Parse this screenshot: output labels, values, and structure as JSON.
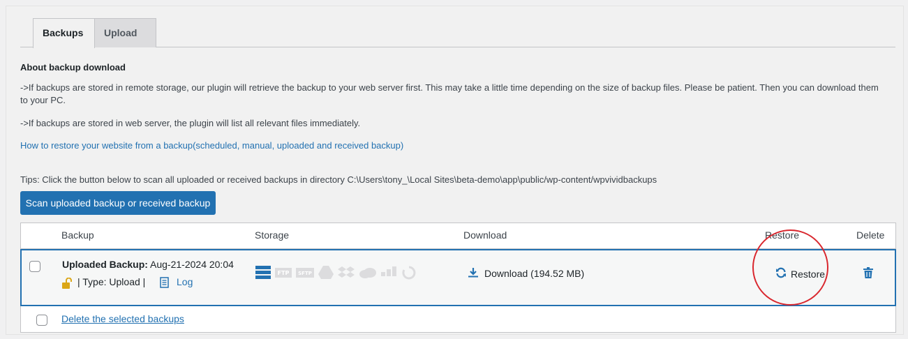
{
  "tabs": [
    {
      "label": "Backups",
      "active": true
    },
    {
      "label": "Upload",
      "active": false
    }
  ],
  "about": {
    "heading": "About backup download",
    "line1": "->If backups are stored in remote storage, our plugin will retrieve the backup to your web server first. This may take a little time depending on the size of backup files. Please be patient. Then you can download them to your PC.",
    "line2": "->If backups are stored in web server, the plugin will list all relevant files immediately.",
    "link": "How to restore your website from a backup(scheduled, manual, uploaded and received backup)"
  },
  "tips": "Tips: Click the button below to scan all uploaded or received backups in directory C:\\Users\\tony_\\Local Sites\\beta-demo\\app\\public/wp-content/wpvividbackups",
  "scan_button": "Scan uploaded backup or received backup",
  "table": {
    "headers": {
      "backup": "Backup",
      "storage": "Storage",
      "download": "Download",
      "restore": "Restore",
      "delete": "Delete"
    },
    "row": {
      "title_bold": "Uploaded Backup:",
      "title_date": " Aug-21-2024 20:04",
      "type_text": "| Type: Upload |",
      "log_label": "Log",
      "storage_icons": [
        "server-icon",
        "ftp-icon",
        "sftp-icon",
        "google-drive-icon",
        "dropbox-icon",
        "onedrive-icon",
        "s3-icon",
        "wasabi-icon"
      ],
      "download_label": "Download (194.52 MB)",
      "restore_label": "Restore"
    },
    "footer": {
      "delete_selected": "Delete the selected backups"
    }
  },
  "colors": {
    "accent": "#2271b1",
    "annotation": "#d9272e",
    "lock": "#dba617",
    "icon_gray": "#c3c4c7"
  }
}
